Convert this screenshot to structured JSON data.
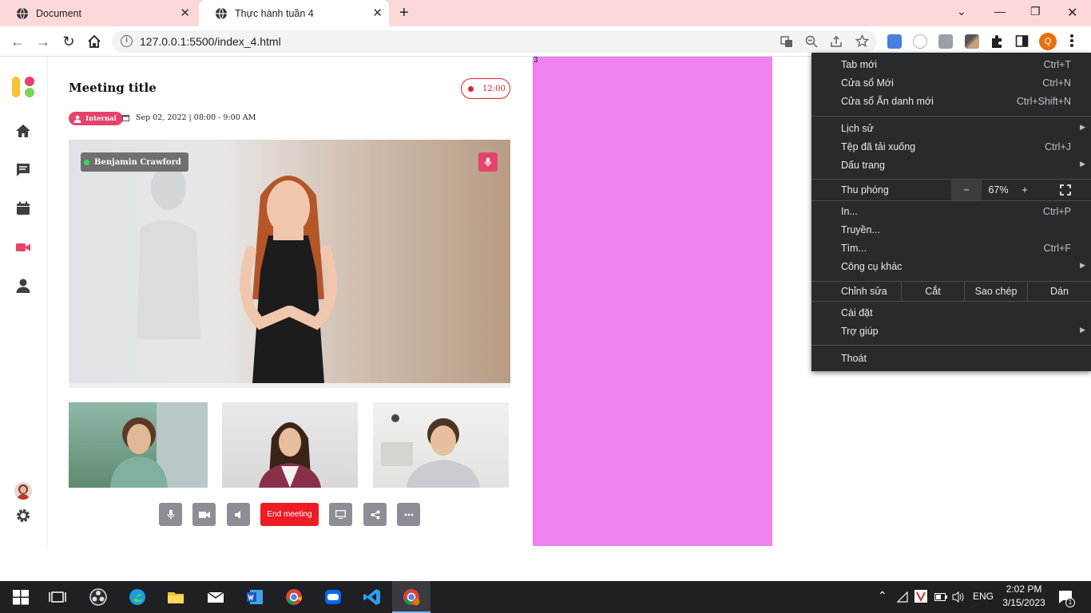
{
  "browser": {
    "tabs": [
      {
        "title": "Document"
      },
      {
        "title": "Thực hành tuần 4"
      }
    ],
    "url": "127.0.0.1:5500/index_4.html",
    "profile_initial": "Q"
  },
  "app": {
    "meeting_title": "Meeting title",
    "recording_time": "12:00",
    "badge": "Internal",
    "datetime": "Sep 02, 2022 | 08:00 - 9:00 AM",
    "speaker_name": "Benjamin Crawford",
    "end_meeting_label": "End meeting",
    "pink_panel_number": "3"
  },
  "menu": {
    "items_top": [
      {
        "label": "Tab mới",
        "shortcut": "Ctrl+T"
      },
      {
        "label": "Cửa sổ Mới",
        "shortcut": "Ctrl+N"
      },
      {
        "label": "Cửa sổ Ẩn danh mới",
        "shortcut": "Ctrl+Shift+N"
      }
    ],
    "items_mid": [
      {
        "label": "Lịch sử",
        "shortcut": ""
      },
      {
        "label": "Tệp đã tải xuống",
        "shortcut": "Ctrl+J"
      },
      {
        "label": "Dấu trang",
        "shortcut": ""
      }
    ],
    "zoom": {
      "label": "Thu phóng",
      "minus": "−",
      "value": "67%",
      "plus": "+"
    },
    "items_tools": [
      {
        "label": "In...",
        "shortcut": "Ctrl+P"
      },
      {
        "label": "Truyền...",
        "shortcut": ""
      },
      {
        "label": "Tìm...",
        "shortcut": "Ctrl+F"
      },
      {
        "label": "Công cụ khác",
        "shortcut": ""
      }
    ],
    "edit": {
      "label": "Chỉnh sửa",
      "cut": "Cắt",
      "copy": "Sao chép",
      "paste": "Dán"
    },
    "items_bottom": [
      {
        "label": "Cài đặt"
      },
      {
        "label": "Trợ giúp"
      }
    ],
    "exit": "Thoát"
  },
  "taskbar": {
    "language": "ENG",
    "time": "2:02 PM",
    "date": "3/15/2023",
    "notification_count": "1"
  }
}
